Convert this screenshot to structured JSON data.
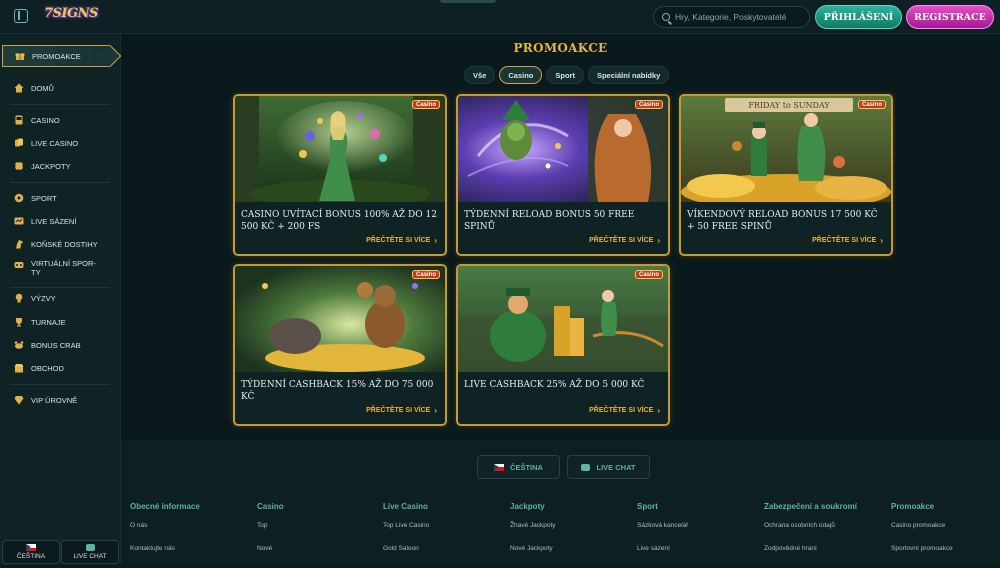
{
  "header": {
    "logo_text": "7SIGNS",
    "search_placeholder": "Hry, Kategorie, Poskytovatelé",
    "login_label": "PŘIHLÁŠENÍ",
    "register_label": "REGISTRACE"
  },
  "sidebar": {
    "items": [
      {
        "label": "PROMOAKCE",
        "icon": "gift-icon"
      },
      {
        "label": "DOMŮ",
        "icon": "home-icon"
      },
      {
        "label": "CASINO",
        "icon": "slot-icon"
      },
      {
        "label": "LIVE CASINO",
        "icon": "cards-icon"
      },
      {
        "label": "JACKPOTY",
        "icon": "clover-icon"
      },
      {
        "label": "SPORT",
        "icon": "ball-icon"
      },
      {
        "label": "LIVE SÁZENÍ",
        "icon": "live-betting-icon"
      },
      {
        "label": "KOŇSKÉ DOSTIHY",
        "icon": "horse-icon"
      },
      {
        "label": "VIRTUÁLNÍ SPOR-TY",
        "icon": "virtual-sports-icon"
      },
      {
        "label": "VÝZVY",
        "icon": "challenge-icon"
      },
      {
        "label": "TURNAJE",
        "icon": "trophy-icon"
      },
      {
        "label": "BONUS CRAB",
        "icon": "crab-icon"
      },
      {
        "label": "OBCHOD",
        "icon": "shop-icon"
      },
      {
        "label": "VIP ÚROVNĚ",
        "icon": "diamond-icon"
      }
    ],
    "bottom_lang": "ČEŠTINA",
    "bottom_chat": "LIVE CHAT"
  },
  "main": {
    "title": "PROMOAKCE",
    "tabs": [
      "Vše",
      "Casino",
      "Sport",
      "Speciální nabídky"
    ],
    "active_tab": "Casino",
    "cards": [
      {
        "badge": "Casino",
        "title": "CASINO UVÍTACÍ BONUS 100% AŽ DO 12 500 KČ + 200 FS",
        "link": "PŘEČTĚTE SI VÍCE"
      },
      {
        "badge": "Casino",
        "title": "TÝDENNÍ RELOAD BONUS 50 FREE SPINŮ",
        "link": "PŘEČTĚTE SI VÍCE"
      },
      {
        "badge": "Casino",
        "title": "VÍKENDOVÝ RELOAD BONUS 17 500 KČ + 50 FREE SPINŮ",
        "link": "PŘEČTĚTE SI VÍCE",
        "banner": "FRIDAY  to  SUNDAY"
      },
      {
        "badge": "Casino",
        "title": "TÝDENNÍ CASHBACK 15% AŽ DO 75 000 KČ",
        "link": "PŘEČTĚTE SI VÍCE"
      },
      {
        "badge": "Casino",
        "title": "LIVE CASHBACK 25% AŽ DO 5 000 KČ",
        "link": "PŘEČTĚTE SI VÍCE"
      }
    ]
  },
  "footer": {
    "lang_button": "ČEŠTINA",
    "chat_button": "LIVE CHAT",
    "columns": [
      {
        "title": "Obecné informace",
        "links": [
          "O nás",
          "Kontaktujte nás"
        ]
      },
      {
        "title": "Casino",
        "links": [
          "Top",
          "Nové"
        ]
      },
      {
        "title": "Live Casino",
        "links": [
          "Top Live Casino",
          "Gold Saloon"
        ]
      },
      {
        "title": "Jackpoty",
        "links": [
          "Žhavé Jackpoty",
          "Nové Jackpoty"
        ]
      },
      {
        "title": "Sport",
        "links": [
          "Sázková kancelář",
          "Live sázení"
        ]
      },
      {
        "title": "Zabezpečení a soukromí",
        "links": [
          "Ochrana osobních údajů",
          "Zodpovědné hraní"
        ]
      },
      {
        "title": "Promoakce",
        "links": [
          "Casino promoakce",
          "Sportovní promoakce"
        ]
      }
    ]
  }
}
